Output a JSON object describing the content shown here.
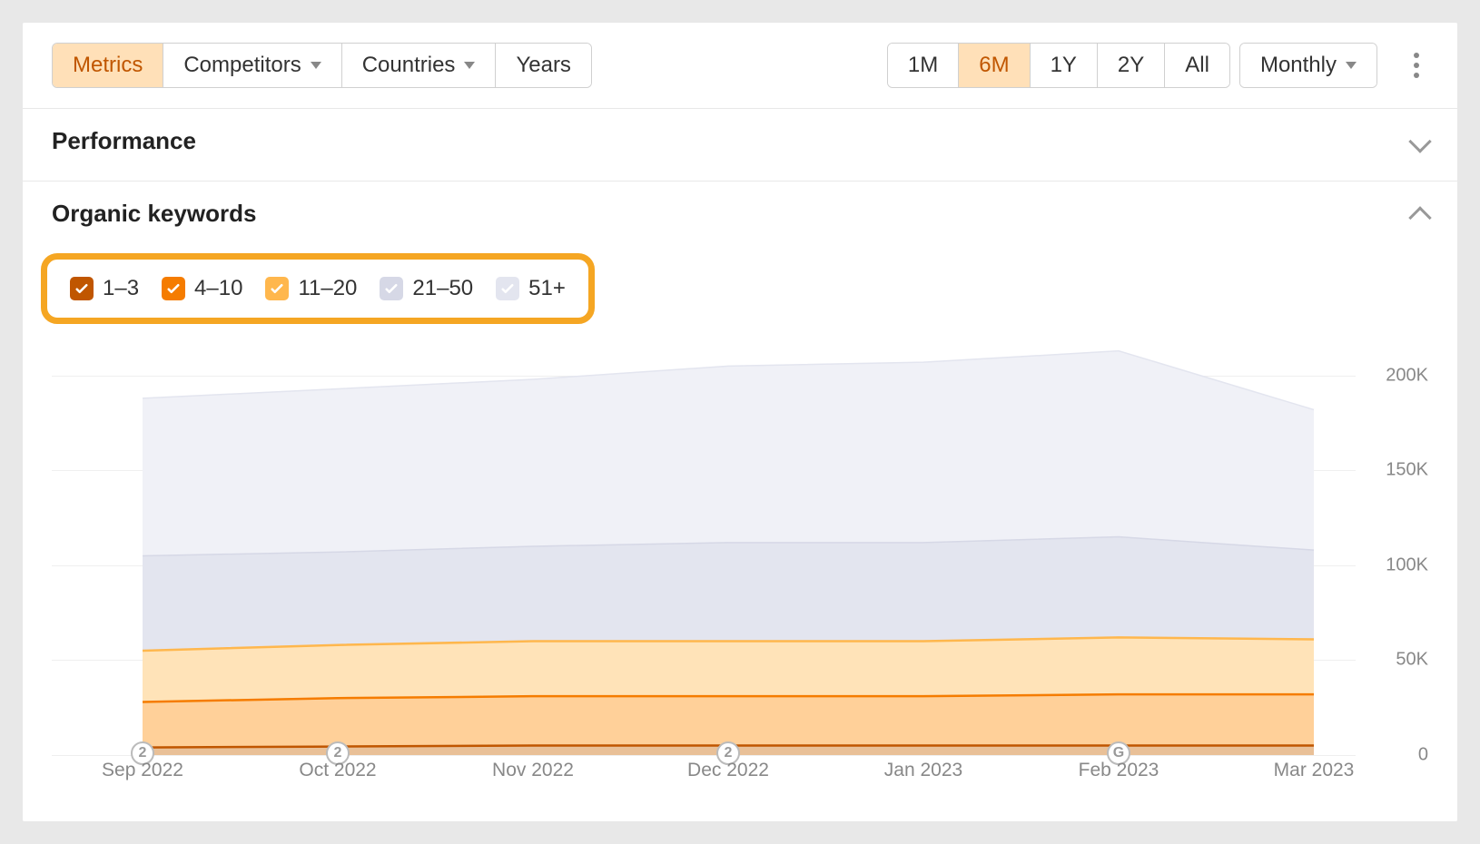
{
  "toolbar": {
    "left_buttons": [
      {
        "label": "Metrics",
        "active": true,
        "dropdown": false
      },
      {
        "label": "Competitors",
        "active": false,
        "dropdown": true
      },
      {
        "label": "Countries",
        "active": false,
        "dropdown": true
      },
      {
        "label": "Years",
        "active": false,
        "dropdown": false
      }
    ],
    "range_buttons": [
      {
        "label": "1M",
        "active": false
      },
      {
        "label": "6M",
        "active": true
      },
      {
        "label": "1Y",
        "active": false
      },
      {
        "label": "2Y",
        "active": false
      },
      {
        "label": "All",
        "active": false
      }
    ],
    "granularity": {
      "label": "Monthly"
    }
  },
  "sections": {
    "performance": {
      "title": "Performance",
      "expanded": false
    },
    "organic_keywords": {
      "title": "Organic keywords",
      "expanded": true
    }
  },
  "legend": [
    {
      "label": "1–3",
      "color": "#c05600",
      "checked": true
    },
    {
      "label": "4–10",
      "color": "#f57c00",
      "checked": true
    },
    {
      "label": "11–20",
      "color": "#ffb74d",
      "checked": true
    },
    {
      "label": "21–50",
      "color": "#d6d8e6",
      "checked": true
    },
    {
      "label": "51+",
      "color": "#e3e5ef",
      "checked": true
    }
  ],
  "chart_data": {
    "type": "area",
    "stacked": true,
    "categories": [
      "Sep 2022",
      "Oct 2022",
      "Nov 2022",
      "Dec 2022",
      "Jan 2023",
      "Feb 2023",
      "Mar 2023"
    ],
    "series": [
      {
        "name": "1–3",
        "color": "#c05600",
        "fill": "#e9c097",
        "values": [
          4000,
          4500,
          5000,
          5000,
          5000,
          5000,
          5000
        ]
      },
      {
        "name": "4–10",
        "color": "#f57c00",
        "fill": "#ffd099",
        "values": [
          24000,
          25500,
          26000,
          26000,
          26000,
          27000,
          27000
        ]
      },
      {
        "name": "11–20",
        "color": "#ffb74d",
        "fill": "#ffe3b8",
        "values": [
          27000,
          28000,
          29000,
          29000,
          29000,
          30000,
          29000
        ]
      },
      {
        "name": "21–50",
        "color": "#d6d8e6",
        "fill": "#e3e5ef",
        "values": [
          50000,
          49000,
          50000,
          52000,
          52000,
          53000,
          47000
        ]
      },
      {
        "name": "51+",
        "color": "#e3e5ef",
        "fill": "#f0f1f7",
        "values": [
          83000,
          86000,
          88000,
          93000,
          95000,
          98000,
          74000
        ]
      }
    ],
    "ylabel": "",
    "xlabel": "",
    "ylim": [
      0,
      220000
    ],
    "y_ticks": [
      0,
      50000,
      100000,
      150000,
      200000
    ],
    "y_tick_labels": [
      "0",
      "50K",
      "100K",
      "150K",
      "200K"
    ],
    "markers": [
      {
        "x": "Sep 2022",
        "label": "2"
      },
      {
        "x": "Oct 2022",
        "label": "2"
      },
      {
        "x": "Dec 2022",
        "label": "2"
      },
      {
        "x": "Feb 2023",
        "label": "G"
      }
    ]
  }
}
